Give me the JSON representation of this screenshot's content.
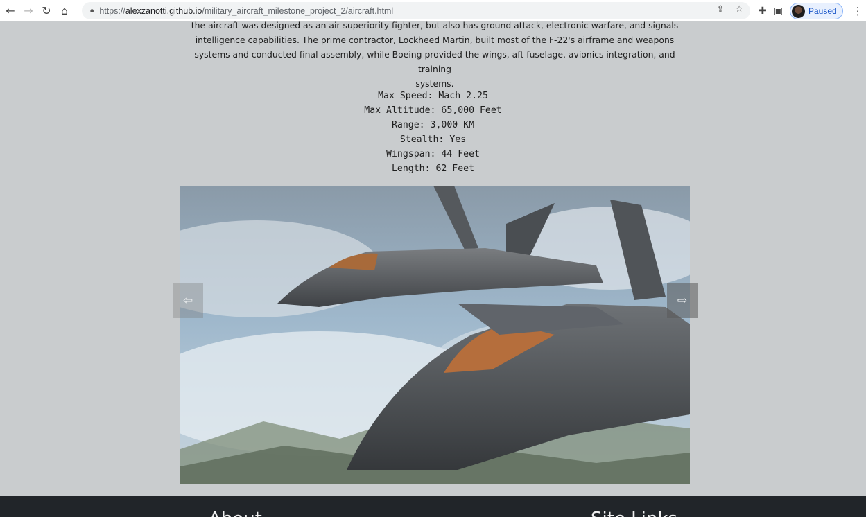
{
  "browser": {
    "url_prefix": "https://",
    "url_host": "alexzanotti.github.io",
    "url_path": "/military_aircraft_milestone_project_2/aircraft.html",
    "profile_status": "Paused"
  },
  "page": {
    "description_lines": [
      "the aircraft was designed as an air superiority fighter, but also has ground attack, electronic warfare, and signals",
      "intelligence capabilities. The prime contractor, Lockheed Martin, built most of the F-22's airframe and weapons",
      "systems and conducted final assembly, while Boeing provided the wings, aft fuselage, avionics integration, and training",
      "systems."
    ],
    "specs": [
      "Max Speed: Mach 2.25",
      "Max Altitude: 65,000 Feet",
      "Range: 3,000 KM",
      "Stealth: Yes",
      "Wingspan: 44 Feet",
      "Length: 62 Feet"
    ],
    "carousel": {
      "prev_icon": "arrow-left-icon",
      "next_icon": "arrow-right-icon",
      "prev_glyph": "⇦",
      "next_glyph": "⇨"
    }
  },
  "footer": {
    "about_heading": "About",
    "site_links_heading": "Site Links"
  },
  "colors": {
    "page_background": "#c9ccce",
    "footer_background": "#212529"
  }
}
